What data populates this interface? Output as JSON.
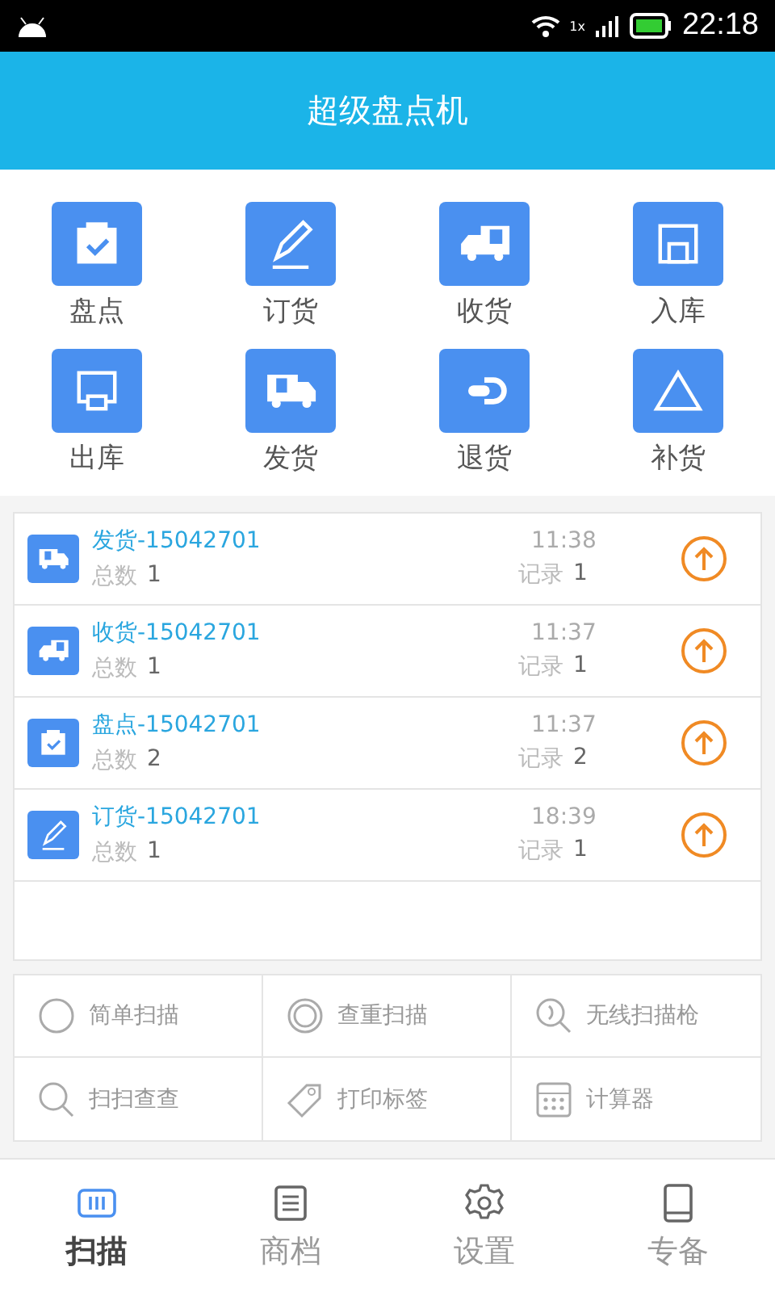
{
  "status_bar": {
    "time": "22:18",
    "network_label": "1x"
  },
  "app_bar": {
    "title": "超级盘点机"
  },
  "modules": [
    {
      "label": "盘点"
    },
    {
      "label": "订货"
    },
    {
      "label": "收货"
    },
    {
      "label": "入库"
    },
    {
      "label": "出库"
    },
    {
      "label": "发货"
    },
    {
      "label": "退货"
    },
    {
      "label": "补货"
    }
  ],
  "records": [
    {
      "title": "发货-15042701",
      "time": "11:38",
      "total_label": "总数",
      "total": "1",
      "record_label": "记录",
      "record": "1"
    },
    {
      "title": "收货-15042701",
      "time": "11:37",
      "total_label": "总数",
      "total": "1",
      "record_label": "记录",
      "record": "1"
    },
    {
      "title": "盘点-15042701",
      "time": "11:37",
      "total_label": "总数",
      "total": "2",
      "record_label": "记录",
      "record": "2"
    },
    {
      "title": "订货-15042701",
      "time": "18:39",
      "total_label": "总数",
      "total": "1",
      "record_label": "记录",
      "record": "1"
    }
  ],
  "tools": [
    {
      "label": "简单扫描"
    },
    {
      "label": "查重扫描"
    },
    {
      "label": "无线扫描枪"
    },
    {
      "label": "扫扫查查"
    },
    {
      "label": "打印标签"
    },
    {
      "label": "计算器"
    }
  ],
  "tabs": [
    {
      "label": "扫描",
      "selected": true
    },
    {
      "label": "商档",
      "selected": false
    },
    {
      "label": "设置",
      "selected": false
    },
    {
      "label": "专备",
      "selected": false
    }
  ]
}
